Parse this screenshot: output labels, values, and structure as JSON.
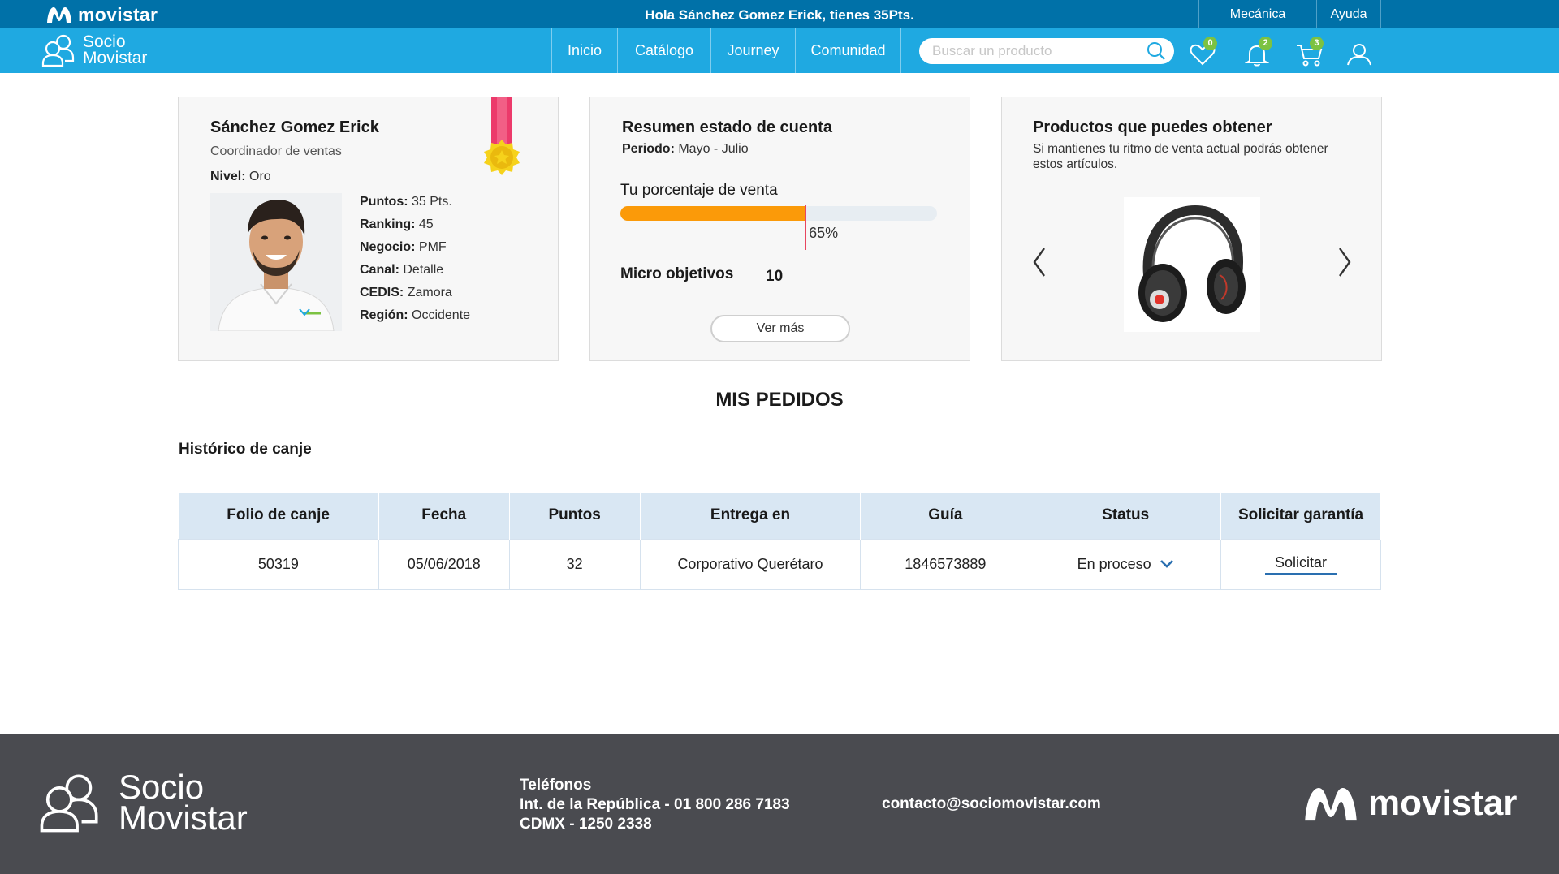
{
  "topbar": {
    "brand": "movistar",
    "greeting": "Hola Sánchez Gomez Erick, tienes 35Pts.",
    "links": {
      "mecanica": "Mecánica",
      "ayuda": "Ayuda"
    }
  },
  "navbar": {
    "logo_line1": "Socio",
    "logo_line2": "Movistar",
    "items": [
      "Inicio",
      "Catálogo",
      "Journey",
      "Comunidad"
    ],
    "search_placeholder": "Buscar un producto",
    "badges": {
      "favorites": "0",
      "notifications": "2",
      "cart": "3"
    }
  },
  "profile": {
    "name": "Sánchez Gomez Erick",
    "role": "Coordinador de ventas",
    "nivel_label": "Nivel:",
    "nivel": "Oro",
    "stats": [
      {
        "label": "Puntos:",
        "value": "35 Pts."
      },
      {
        "label": "Ranking:",
        "value": "45"
      },
      {
        "label": "Negocio:",
        "value": "PMF"
      },
      {
        "label": "Canal:",
        "value": "Detalle"
      },
      {
        "label": "CEDIS:",
        "value": "Zamora"
      },
      {
        "label": "Región:",
        "value": "Occidente"
      }
    ]
  },
  "account": {
    "title": "Resumen estado de cuenta",
    "period_label": "Periodo:",
    "period": "Mayo - Julio",
    "percent_label": "Tu porcentaje de venta",
    "percent_value": 58.5,
    "percent_text": "65%",
    "micro_label": "Micro objetivos",
    "micro_value": "10",
    "button": "Ver más"
  },
  "products": {
    "title": "Productos que puedes obtener",
    "description": "Si mantienes tu ritmo de venta actual podrás obtener estos artículos."
  },
  "orders": {
    "title": "MIS PEDIDOS",
    "subtitle": "Histórico de canje",
    "columns": [
      "Folio de canje",
      "Fecha",
      "Puntos",
      "Entrega en",
      "Guía",
      "Status",
      "Solicitar garantía"
    ],
    "rows": [
      {
        "folio": "50319",
        "fecha": "05/06/2018",
        "puntos": "32",
        "entrega": "Corporativo Querétaro",
        "guia": "1846573889",
        "status": "En proceso",
        "action": "Solicitar"
      }
    ]
  },
  "footer": {
    "logo_line1": "Socio",
    "logo_line2": "Movistar",
    "phones_title": "Teléfonos",
    "phone1": "Int. de la República - 01 800 286 7183",
    "phone2": "CDMX - 1250 2338",
    "email": "contacto@sociomovistar.com",
    "brand": "movistar"
  },
  "colors": {
    "topbar": "#0071a8",
    "navbar": "#1fa9e1",
    "progress": "#fb9a09",
    "badge": "#7cc242",
    "table_header": "#d9e7f3",
    "footer": "#4a4b50"
  }
}
